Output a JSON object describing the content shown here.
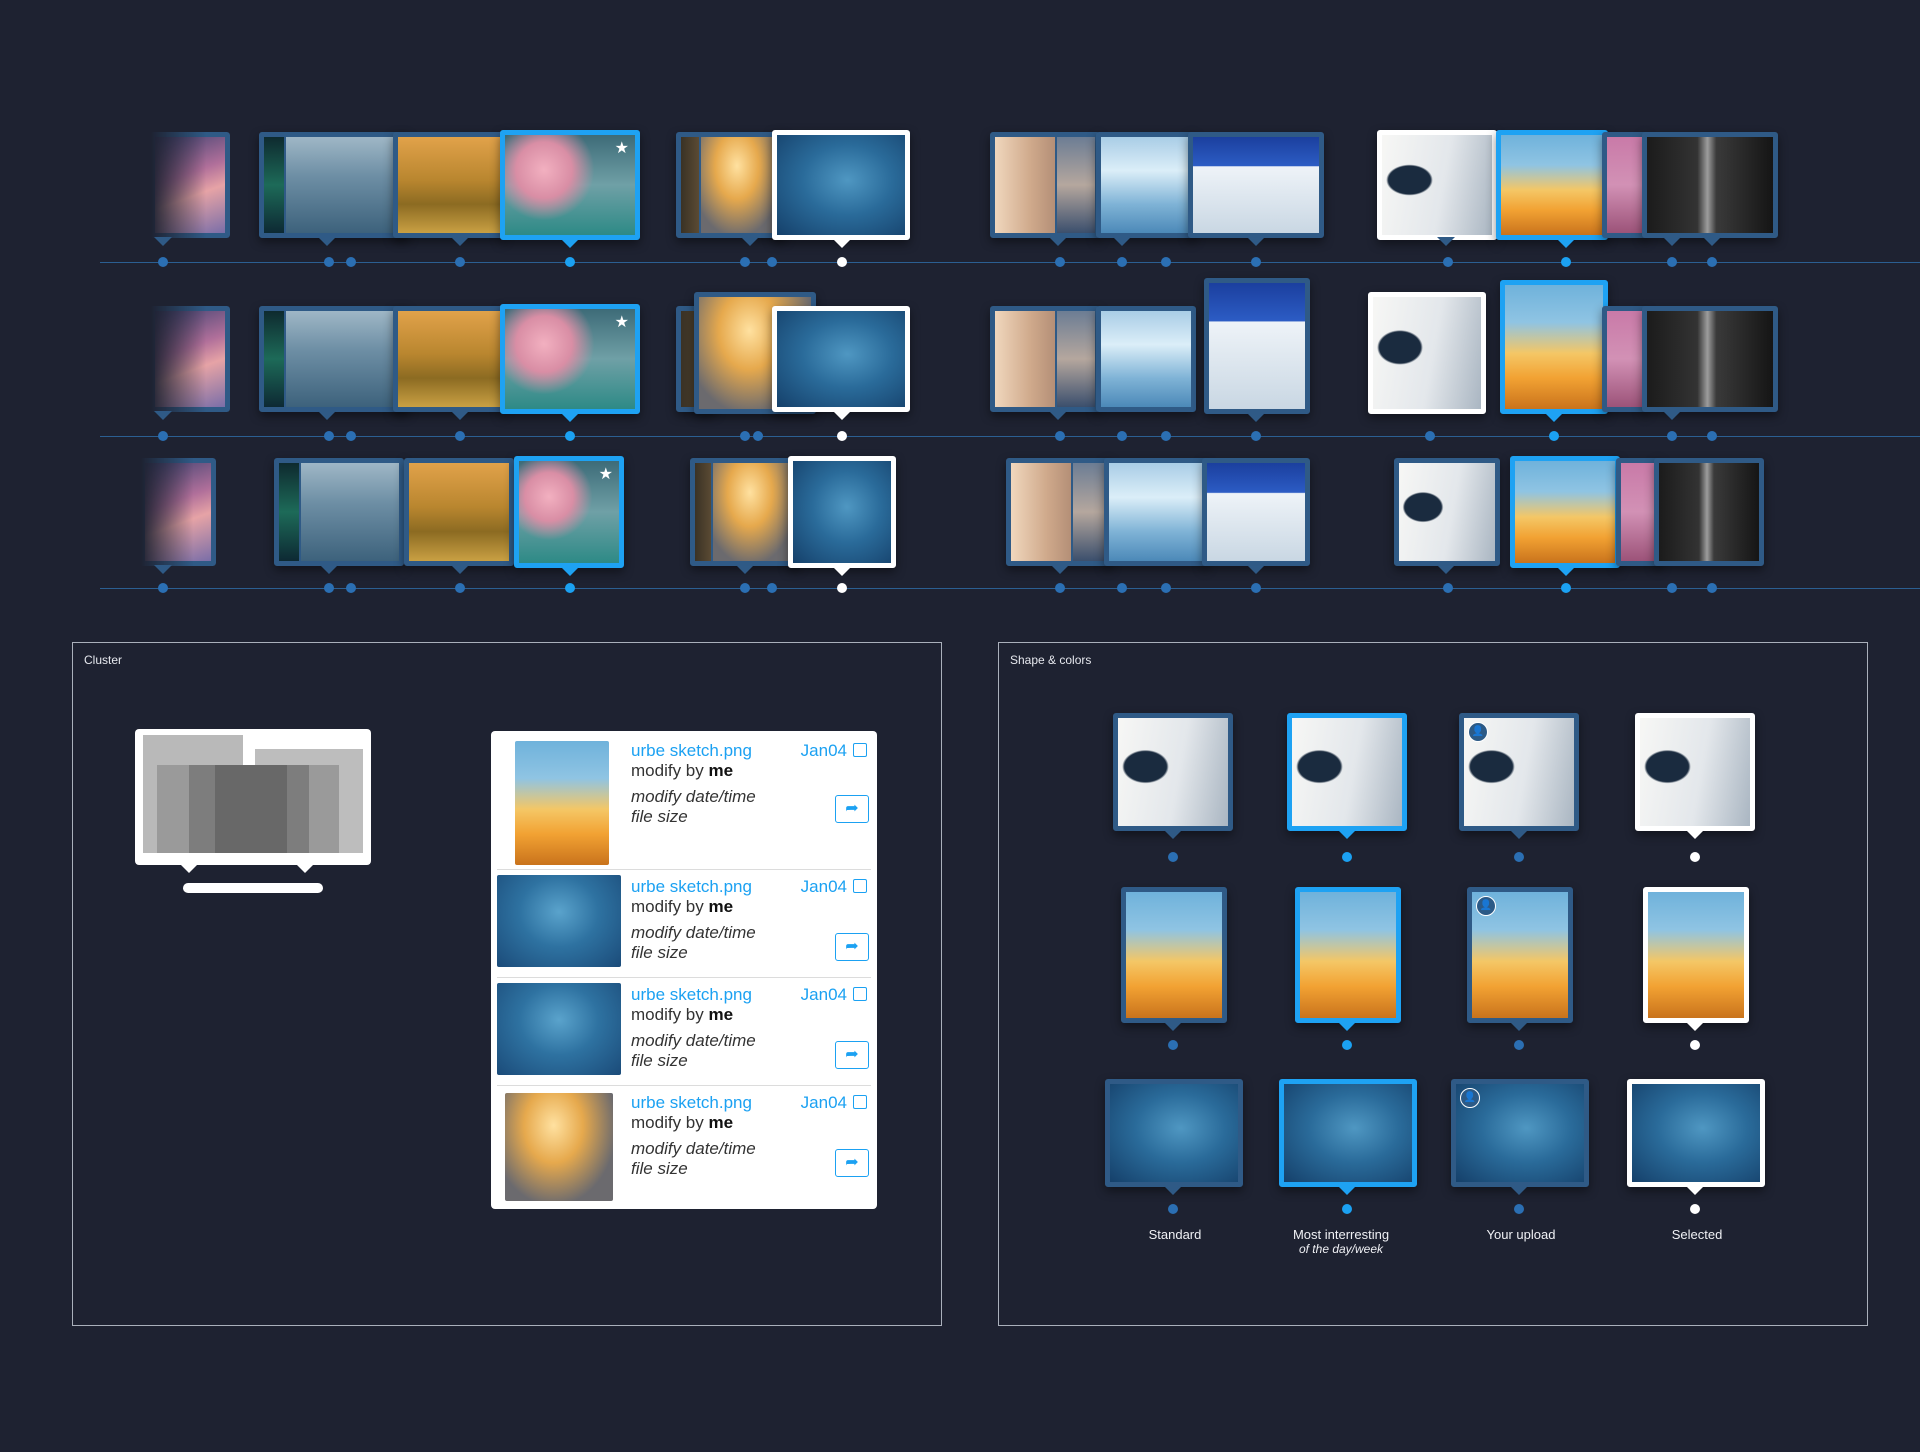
{
  "timeline": {
    "rows": [
      {
        "variant": "expanded"
      },
      {
        "variant": "hover"
      },
      {
        "variant": "compact"
      }
    ]
  },
  "cluster_panel": {
    "title": "Cluster",
    "items": [
      {
        "name": "urbe sketch.png",
        "date": "Jan04",
        "modify_prefix": "modify by",
        "modify_user": "me",
        "meta1": "modify date/time",
        "meta2": "file size",
        "thumb": "surf"
      },
      {
        "name": "urbe sketch.png",
        "date": "Jan04",
        "modify_prefix": "modify by",
        "modify_user": "me",
        "meta1": "modify date/time",
        "meta2": "file size",
        "thumb": "whale"
      },
      {
        "name": "urbe sketch.png",
        "date": "Jan04",
        "modify_prefix": "modify by",
        "modify_user": "me",
        "meta1": "modify date/time",
        "meta2": "file size",
        "thumb": "whale"
      },
      {
        "name": "urbe sketch.png",
        "date": "Jan04",
        "modify_prefix": "modify by",
        "modify_user": "me",
        "meta1": "modify date/time",
        "meta2": "file size",
        "thumb": "clouds"
      }
    ]
  },
  "shapes_panel": {
    "title": "Shape & colors",
    "columns": [
      {
        "label": "Standard",
        "sublabel": ""
      },
      {
        "label": "Most interresting",
        "sublabel": "of the day/week"
      },
      {
        "label": "Your upload",
        "sublabel": ""
      },
      {
        "label": "Selected",
        "sublabel": ""
      }
    ]
  },
  "colors": {
    "background": "#1e2231",
    "standard": "#2f5a86",
    "interesting": "#1ea2f3",
    "selected": "#ffffff"
  }
}
